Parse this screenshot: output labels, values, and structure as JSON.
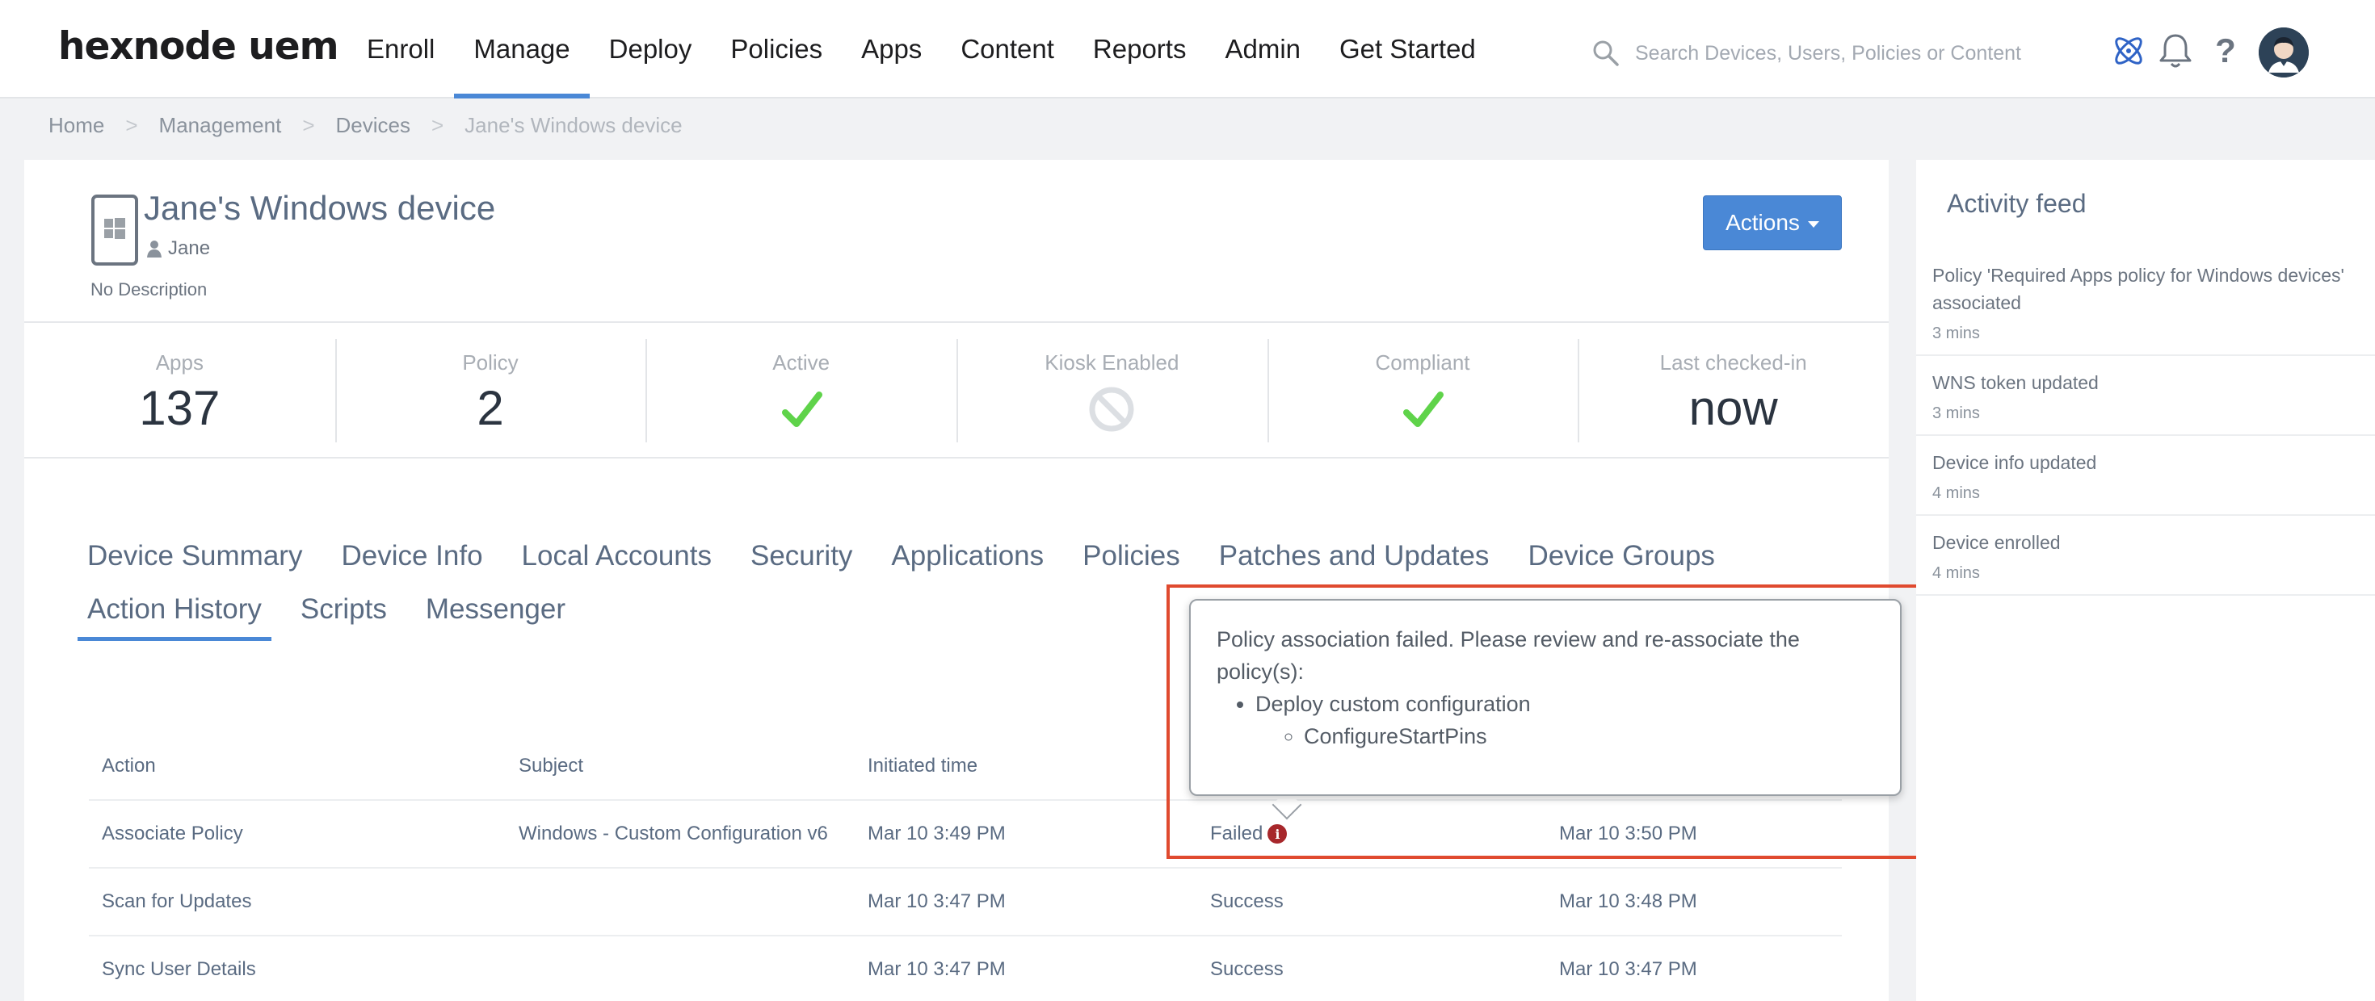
{
  "app": {
    "logo_text": "hexnode uem",
    "nav": [
      "Enroll",
      "Manage",
      "Deploy",
      "Policies",
      "Apps",
      "Content",
      "Reports",
      "Admin",
      "Get Started"
    ],
    "active_nav": "Manage",
    "search_placeholder": "Search Devices, Users, Policies or Content"
  },
  "breadcrumb": {
    "items": [
      "Home",
      "Management",
      "Devices",
      "Jane's Windows device"
    ],
    "separator": ">"
  },
  "device": {
    "name": "Jane's Windows device",
    "user": "Jane",
    "description": "No Description",
    "actions_label": "Actions"
  },
  "stats": [
    {
      "label": "Apps",
      "value": "137"
    },
    {
      "label": "Policy",
      "value": "2"
    },
    {
      "label": "Active",
      "icon": "check-icon"
    },
    {
      "label": "Kiosk Enabled",
      "icon": "disabled-icon"
    },
    {
      "label": "Compliant",
      "icon": "check-icon"
    },
    {
      "label": "Last checked-in",
      "value": "now"
    }
  ],
  "tabs": {
    "row1": [
      "Device Summary",
      "Device Info",
      "Local Accounts",
      "Security",
      "Applications",
      "Policies",
      "Patches and Updates",
      "Device Groups"
    ],
    "row2": [
      "Action History",
      "Scripts",
      "Messenger"
    ],
    "active": "Action History"
  },
  "history": {
    "headers": [
      "Action",
      "Subject",
      "Initiated time",
      "",
      ""
    ],
    "rows": [
      {
        "action": "Associate Policy",
        "subject": "Windows - Custom Configuration v6",
        "initiated": "Mar 10 3:49 PM",
        "status": "Failed",
        "completed": "Mar 10 3:50 PM"
      },
      {
        "action": "Scan for Updates",
        "subject": "",
        "initiated": "Mar 10 3:47 PM",
        "status": "Success",
        "completed": "Mar 10 3:48 PM"
      },
      {
        "action": "Sync User Details",
        "subject": "",
        "initiated": "Mar 10 3:47 PM",
        "status": "Success",
        "completed": "Mar 10 3:47 PM"
      }
    ]
  },
  "tooltip": {
    "message": "Policy association failed. Please review and re-associate the policy(s):",
    "item": "Deploy custom configuration",
    "subitem": "ConfigureStartPins"
  },
  "feed": {
    "title": "Activity feed",
    "items": [
      {
        "text": "Policy 'Required Apps policy for Windows devices' associated",
        "time": "3 mins"
      },
      {
        "text": "WNS token updated",
        "time": "3 mins"
      },
      {
        "text": "Device info updated",
        "time": "4 mins"
      },
      {
        "text": "Device enrolled",
        "time": "4 mins"
      }
    ]
  },
  "colors": {
    "accent": "#4a88d6",
    "check": "#5fd34a",
    "failed_icon": "#a7272b",
    "highlight": "#e04a2f"
  }
}
